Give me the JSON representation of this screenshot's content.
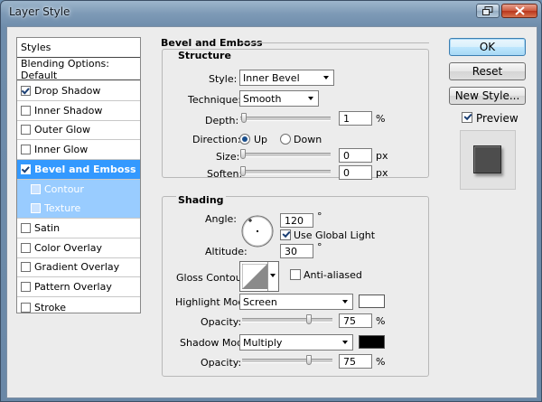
{
  "window": {
    "title": "Layer Style"
  },
  "styles_list": {
    "header": "Styles",
    "blending": "Blending Options: Default",
    "items": [
      {
        "label": "Drop Shadow",
        "checked": true
      },
      {
        "label": "Inner Shadow",
        "checked": false
      },
      {
        "label": "Outer Glow",
        "checked": false
      },
      {
        "label": "Inner Glow",
        "checked": false
      },
      {
        "label": "Bevel and Emboss",
        "checked": true,
        "selected": true
      },
      {
        "label": "Contour",
        "checked": false,
        "sub": true
      },
      {
        "label": "Texture",
        "checked": false,
        "sub": true
      },
      {
        "label": "Satin",
        "checked": false
      },
      {
        "label": "Color Overlay",
        "checked": false
      },
      {
        "label": "Gradient Overlay",
        "checked": false
      },
      {
        "label": "Pattern Overlay",
        "checked": false
      },
      {
        "label": "Stroke",
        "checked": false
      }
    ]
  },
  "bevel": {
    "heading": "Bevel and Emboss",
    "structure": {
      "heading": "Structure",
      "style_label": "Style:",
      "style_value": "Inner Bevel",
      "technique_label": "Technique:",
      "technique_value": "Smooth",
      "depth_label": "Depth:",
      "depth_value": "1",
      "depth_unit": "%",
      "direction_label": "Direction:",
      "direction_up": "Up",
      "direction_down": "Down",
      "size_label": "Size:",
      "size_value": "0",
      "size_unit": "px",
      "soften_label": "Soften:",
      "soften_value": "0",
      "soften_unit": "px"
    },
    "shading": {
      "heading": "Shading",
      "angle_label": "Angle:",
      "angle_value": "120",
      "angle_unit": "°",
      "global_light_label": "Use Global Light",
      "global_light_checked": true,
      "altitude_label": "Altitude:",
      "altitude_value": "30",
      "altitude_unit": "°",
      "gloss_label": "Gloss Contour:",
      "anti_aliased_label": "Anti-aliased",
      "anti_aliased_checked": false,
      "highlight_mode_label": "Highlight Mode:",
      "highlight_mode_value": "Screen",
      "highlight_color": "#ffffff",
      "opacity_label": "Opacity:",
      "highlight_opacity": "75",
      "opacity_unit": "%",
      "shadow_mode_label": "Shadow Mode:",
      "shadow_mode_value": "Multiply",
      "shadow_color": "#000000",
      "shadow_opacity_label": "Opacity:",
      "shadow_opacity": "75",
      "shadow_opacity_unit": "%"
    }
  },
  "buttons": {
    "ok": "OK",
    "reset": "Reset",
    "new_style": "New Style...",
    "preview": "Preview",
    "preview_checked": true
  },
  "icons": {
    "restore": "restore-icon",
    "close": "close-icon",
    "dropdown": "chevron-down-icon"
  }
}
